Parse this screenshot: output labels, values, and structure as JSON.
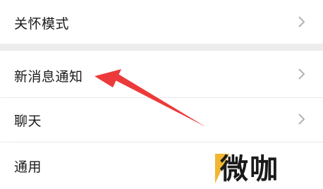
{
  "settings": {
    "items": [
      {
        "label": "关怀模式"
      },
      {
        "label": "新消息通知"
      },
      {
        "label": "聊天"
      },
      {
        "label": "通用"
      }
    ]
  },
  "icons": {
    "chevron": "chevron-right-icon",
    "annotation": "red-arrow"
  },
  "colors": {
    "background": "#ededed",
    "row": "#ffffff",
    "text": "#1a1a1a",
    "chevron": "#b2b2b2",
    "arrow": "#ec3a3a",
    "watermark_accent": "#f2b632"
  },
  "watermark": {
    "text": "微咖"
  }
}
